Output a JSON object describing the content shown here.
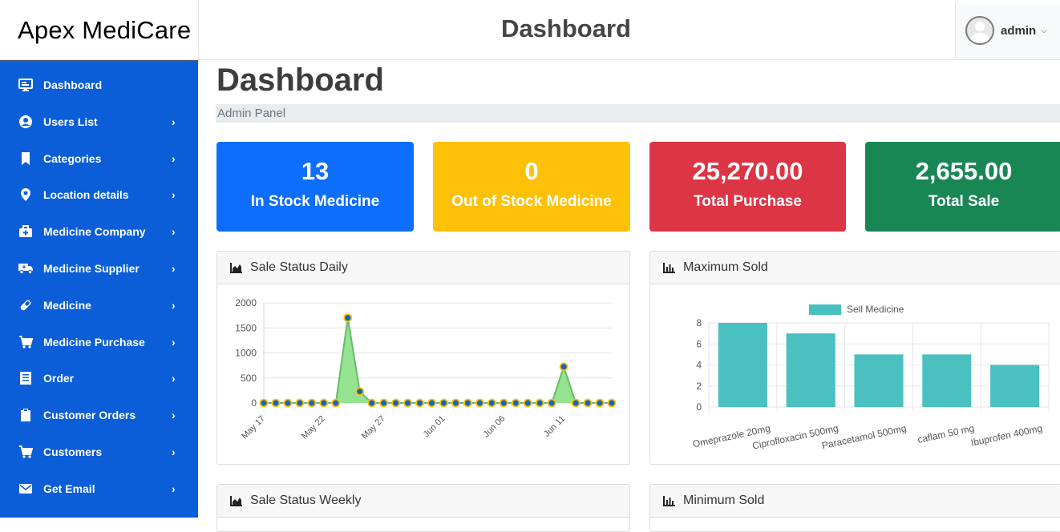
{
  "brand": {
    "name": "Apex MediCare"
  },
  "header": {
    "title": "Dashboard"
  },
  "user": {
    "name": "admin",
    "caret": "⌄"
  },
  "sidebar": {
    "items": [
      {
        "label": "Dashboard",
        "icon": "monitor-icon",
        "arrow": ""
      },
      {
        "label": "Users List",
        "icon": "user-circle-icon",
        "arrow": "›"
      },
      {
        "label": "Categories",
        "icon": "bookmark-icon",
        "arrow": "›"
      },
      {
        "label": "Location details",
        "icon": "map-pin-icon",
        "arrow": "›"
      },
      {
        "label": "Medicine Company",
        "icon": "medkit-icon",
        "arrow": "›"
      },
      {
        "label": "Medicine Supplier",
        "icon": "truck-icon",
        "arrow": "›"
      },
      {
        "label": "Medicine",
        "icon": "pill-icon",
        "arrow": "›"
      },
      {
        "label": "Medicine Purchase",
        "icon": "cart-icon",
        "arrow": "›"
      },
      {
        "label": "Order",
        "icon": "receipt-icon",
        "arrow": "›"
      },
      {
        "label": "Customer Orders",
        "icon": "clipboard-icon",
        "arrow": "›"
      },
      {
        "label": "Customers",
        "icon": "cart-icon",
        "arrow": "›"
      },
      {
        "label": "Get Email",
        "icon": "envelope-icon",
        "arrow": "›"
      }
    ]
  },
  "main": {
    "title": "Dashboard",
    "breadcrumb": "Admin Panel",
    "cards": [
      {
        "value": "13",
        "label": "In Stock Medicine",
        "color": "#0d6efd"
      },
      {
        "value": "0",
        "label": "Out of Stock Medicine",
        "color": "#ffc107"
      },
      {
        "value": "25,270.00",
        "label": "Total Purchase",
        "color": "#dc3545"
      },
      {
        "value": "2,655.00",
        "label": "Total Sale",
        "color": "#198754"
      }
    ],
    "panels": {
      "daily": "Sale Status Daily",
      "max": "Maximum Sold",
      "weekly": "Sale Status Weekly",
      "min": "Minimum Sold"
    }
  },
  "chart_data": [
    {
      "type": "area",
      "title": "Sale Status Daily",
      "x_tick_labels": [
        "May 17",
        "May 22",
        "May 27",
        "Jun 01",
        "Jun 06",
        "Jun 11"
      ],
      "x": [
        "May 17",
        "May 18",
        "May 19",
        "May 20",
        "May 21",
        "May 22",
        "May 23",
        "May 24",
        "May 25",
        "May 26",
        "May 27",
        "May 28",
        "May 29",
        "May 30",
        "May 31",
        "Jun 01",
        "Jun 02",
        "Jun 03",
        "Jun 04",
        "Jun 05",
        "Jun 06",
        "Jun 07",
        "Jun 08",
        "Jun 09",
        "Jun 10",
        "Jun 11",
        "Jun 12",
        "Jun 13",
        "Jun 14",
        "Jun 15"
      ],
      "values": [
        0,
        0,
        0,
        0,
        0,
        0,
        0,
        1700,
        230,
        0,
        0,
        0,
        0,
        0,
        0,
        0,
        0,
        0,
        0,
        0,
        0,
        0,
        0,
        0,
        0,
        725,
        0,
        0,
        0,
        0
      ],
      "yticks": [
        0,
        500,
        1000,
        1500,
        2000
      ],
      "ylim": [
        0,
        2000
      ],
      "fill_color": "#8fe08a",
      "line_color": "#66bb6a",
      "point_color": "#1565c0",
      "point_border": "#ffc107"
    },
    {
      "type": "bar",
      "title": "Maximum Sold",
      "categories": [
        "Omeprazole 20mg",
        "Ciprofloxacin 500mg",
        "Paracetamol 500mg",
        "caflam 50 mg",
        "Ibuprofen 400mg"
      ],
      "series": [
        {
          "name": "Sell Medicine",
          "values": [
            8,
            7,
            5,
            5,
            4
          ]
        }
      ],
      "yticks": [
        0,
        2,
        4,
        6,
        8
      ],
      "ylim": [
        0,
        8
      ],
      "bar_color": "#4bc0c0"
    }
  ]
}
